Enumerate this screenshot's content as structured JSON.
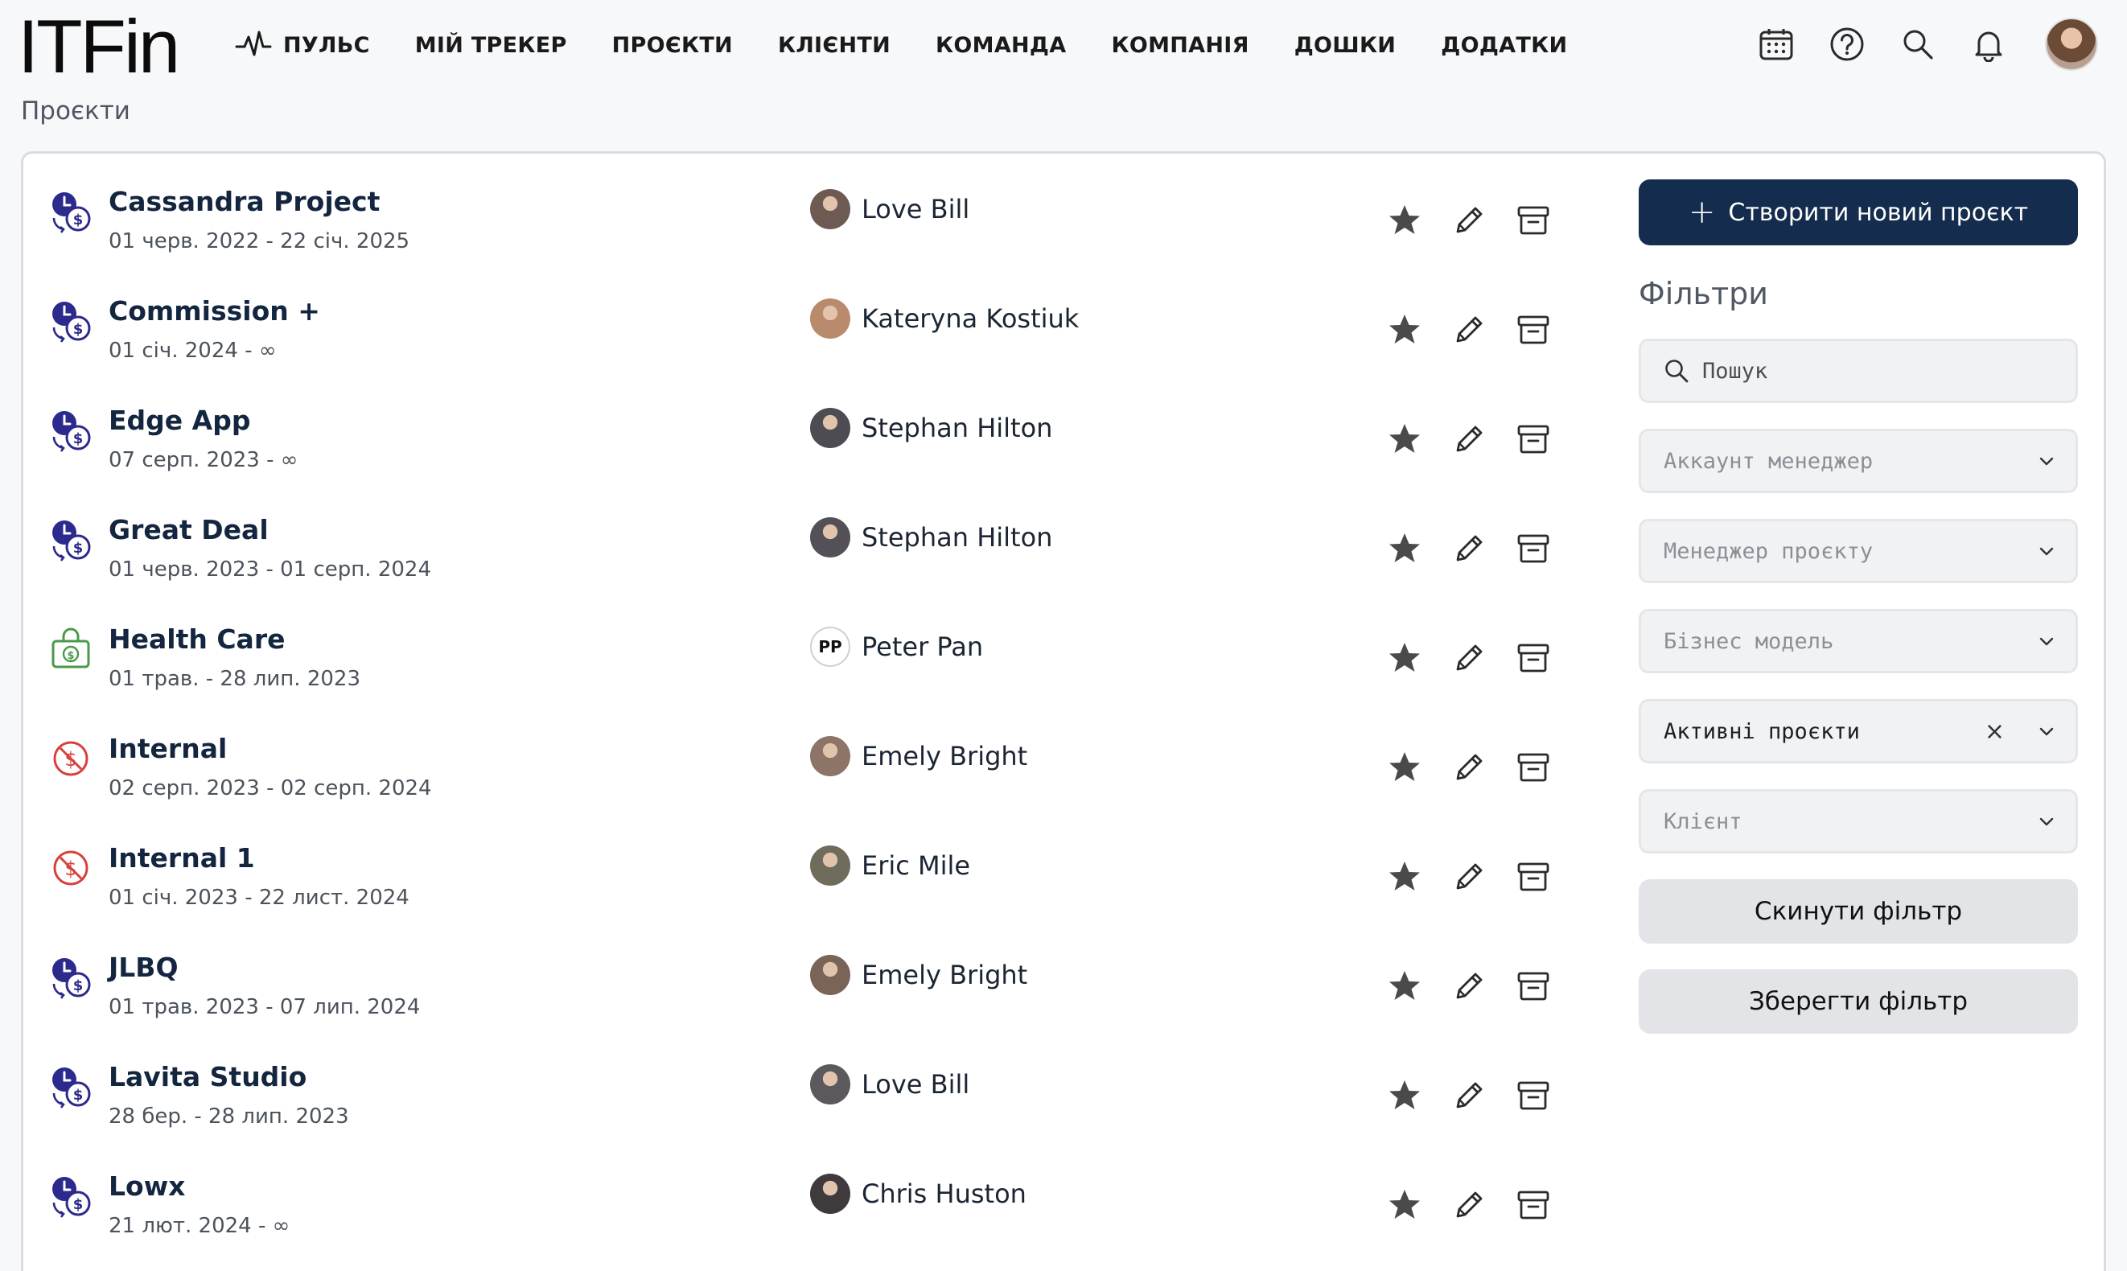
{
  "app": {
    "logo": "ITFin"
  },
  "nav": [
    {
      "label": "ПУЛЬС",
      "icon": "pulse-icon"
    },
    {
      "label": "МІЙ ТРЕКЕР"
    },
    {
      "label": "ПРОЄКТИ"
    },
    {
      "label": "КЛІЄНТИ"
    },
    {
      "label": "КОМАНДА"
    },
    {
      "label": "КОМПАНІЯ"
    },
    {
      "label": "ДОШКИ"
    },
    {
      "label": "ДОДАТКИ"
    }
  ],
  "top_icons": [
    "calendar-icon",
    "help-icon",
    "search-icon",
    "bell-icon",
    "avatar"
  ],
  "breadcrumb": "Проєкти",
  "projects": [
    {
      "name": "Cassandra Project",
      "dates": "01 черв. 2022 - 22 січ. 2025",
      "type": "time-money-icon",
      "manager": "Love Bill",
      "avatar": "photo"
    },
    {
      "name": "Commission +",
      "dates": "01 січ. 2024 - ∞",
      "type": "time-money-icon",
      "manager": "Kateryna Kostiuk",
      "avatar": "photo"
    },
    {
      "name": "Edge App",
      "dates": "07 серп. 2023 - ∞",
      "type": "time-money-icon",
      "manager": "Stephan Hilton",
      "avatar": "photo"
    },
    {
      "name": "Great Deal",
      "dates": "01 черв. 2023 - 01 серп. 2024",
      "type": "time-money-icon",
      "manager": "Stephan Hilton",
      "avatar": "photo"
    },
    {
      "name": "Health Care",
      "dates": "01 трав. - 28 лип. 2023",
      "type": "fixed-price-icon",
      "manager": "Peter Pan",
      "avatar": "PP"
    },
    {
      "name": "Internal",
      "dates": "02 серп. 2023 - 02 серп. 2024",
      "type": "no-money-icon",
      "manager": "Emely Bright",
      "avatar": "photo"
    },
    {
      "name": "Internal 1",
      "dates": "01 січ. 2023 - 22 лист. 2024",
      "type": "no-money-icon",
      "manager": "Eric Mile",
      "avatar": "photo"
    },
    {
      "name": "JLBQ",
      "dates": "01 трав. 2023 - 07 лип. 2024",
      "type": "time-money-icon",
      "manager": "Emely Bright",
      "avatar": "photo"
    },
    {
      "name": "Lavita Studio",
      "dates": "28 бер. - 28 лип. 2023",
      "type": "time-money-icon",
      "manager": "Love Bill",
      "avatar": "photo"
    },
    {
      "name": "Lowx",
      "dates": "21 лют. 2024 - ∞",
      "type": "time-money-icon",
      "manager": "Chris Huston",
      "avatar": "photo"
    }
  ],
  "row_actions": [
    "star-icon",
    "edit-icon",
    "archive-icon"
  ],
  "side": {
    "create_button": "Створити новий проєкт",
    "filters_title": "Фільтри",
    "search_placeholder": "Пошук",
    "selects": [
      {
        "value": "Аккаунт менеджер",
        "active": false
      },
      {
        "value": "Менеджер проєкту",
        "active": false
      },
      {
        "value": "Бізнес модель",
        "active": false
      },
      {
        "value": "Активні проєкти",
        "active": true
      },
      {
        "value": "Клієнт",
        "active": false
      }
    ],
    "reset_button": "Скинути фільтр",
    "save_button": "Зберегти фільтр"
  },
  "colors": {
    "primary": "#142c4d",
    "tm_icon": "#2c2a8c",
    "fixed_icon": "#4a9a4a",
    "internal_icon": "#d8403c"
  }
}
